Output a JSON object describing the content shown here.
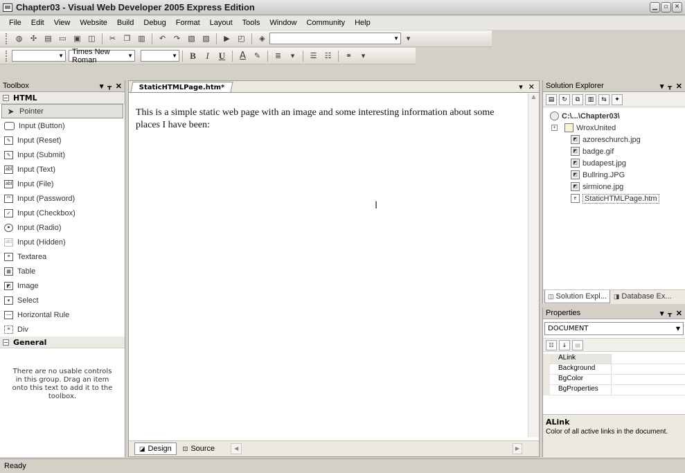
{
  "window": {
    "title": "Chapter03 - Visual Web Developer 2005 Express Edition"
  },
  "menu": [
    "File",
    "Edit",
    "View",
    "Website",
    "Build",
    "Debug",
    "Format",
    "Layout",
    "Tools",
    "Window",
    "Community",
    "Help"
  ],
  "format_toolbar": {
    "font_name": "Times New Roman"
  },
  "toolbox": {
    "title": "Toolbox",
    "html_group": "HTML",
    "items": [
      "Pointer",
      "Input (Button)",
      "Input (Reset)",
      "Input (Submit)",
      "Input (Text)",
      "Input (File)",
      "Input (Password)",
      "Input (Checkbox)",
      "Input (Radio)",
      "Input (Hidden)",
      "Textarea",
      "Table",
      "Image",
      "Select",
      "Horizontal Rule",
      "Div"
    ],
    "general_group": "General",
    "empty_message": "There are no usable controls in this group. Drag an item onto this text to add it to the toolbox."
  },
  "editor": {
    "tab_label": "StaticHTMLPage.htm*",
    "content": "This is a simple static web page with an image and some interesting information about some places I have been:",
    "design_label": "Design",
    "source_label": "Source"
  },
  "solution_explorer": {
    "title": "Solution Explorer",
    "root": "C:\\...\\Chapter03\\",
    "folder": "WroxUnited",
    "files": [
      "azoreschurch.jpg",
      "badge.gif",
      "budapest.jpg",
      "Bullring.JPG",
      "sirmione.jpg",
      "StaticHTMLPage.htm"
    ],
    "tab1": "Solution Expl...",
    "tab2": "Database Ex..."
  },
  "properties": {
    "title": "Properties",
    "object": "DOCUMENT",
    "rows": [
      "ALink",
      "Background",
      "BgColor",
      "BgProperties"
    ],
    "desc_title": "ALink",
    "desc_text": "Color of all active links in the document."
  },
  "status": {
    "text": "Ready"
  }
}
